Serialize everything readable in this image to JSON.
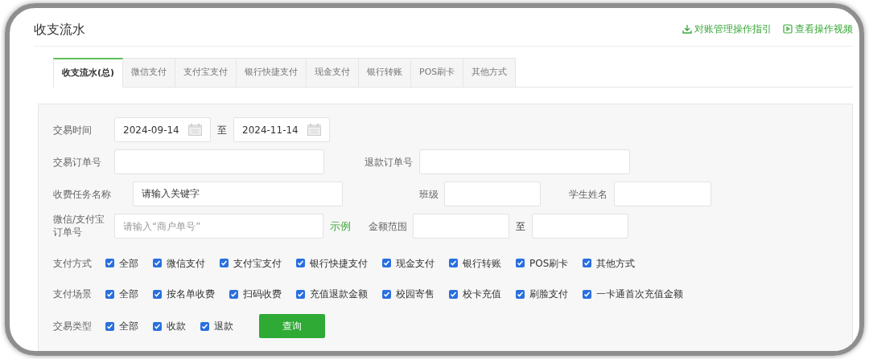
{
  "header": {
    "title": "收支流水",
    "links": [
      {
        "kind": "download",
        "label": "对账管理操作指引"
      },
      {
        "kind": "video",
        "label": "查看操作视频"
      }
    ]
  },
  "tabs": [
    {
      "label": "收支流水(总)",
      "selected": true
    },
    {
      "label": "微信支付",
      "selected": false
    },
    {
      "label": "支付宝支付",
      "selected": false
    },
    {
      "label": "银行快捷支付",
      "selected": false
    },
    {
      "label": "现金支付",
      "selected": false
    },
    {
      "label": "银行转账",
      "selected": false
    },
    {
      "label": "POS刷卡",
      "selected": false
    },
    {
      "label": "其他方式",
      "selected": false
    }
  ],
  "filters": {
    "date": {
      "label": "交易时间",
      "from": "2024-09-14",
      "separator": "至",
      "to": "2024-11-14"
    },
    "order_no": {
      "label": "交易订单号"
    },
    "refund_no": {
      "label": "退款订单号"
    },
    "task_name": {
      "label": "收费任务名称",
      "value": "请输入关键字"
    },
    "class_name": {
      "label": "班级"
    },
    "student": {
      "label": "学生姓名"
    },
    "merchant_no": {
      "label": "微信/支付宝订单号",
      "placeholder": "请输入“商户单号”",
      "example_link": "示例"
    },
    "amount": {
      "label": "金额范围",
      "separator": "至"
    },
    "check_groups": [
      {
        "label": "支付方式",
        "options": [
          {
            "label": "全部",
            "checked": true
          },
          {
            "label": "微信支付",
            "checked": true
          },
          {
            "label": "支付宝支付",
            "checked": true
          },
          {
            "label": "银行快捷支付",
            "checked": true
          },
          {
            "label": "现金支付",
            "checked": true
          },
          {
            "label": "银行转账",
            "checked": true
          },
          {
            "label": "POS刷卡",
            "checked": true
          },
          {
            "label": "其他方式",
            "checked": true
          }
        ]
      },
      {
        "label": "支付场景",
        "options": [
          {
            "label": "全部",
            "checked": true
          },
          {
            "label": "按名单收费",
            "checked": true
          },
          {
            "label": "扫码收费",
            "checked": true
          },
          {
            "label": "充值退款金额",
            "checked": true
          },
          {
            "label": "校园寄售",
            "checked": true
          },
          {
            "label": "校卡充值",
            "checked": true
          },
          {
            "label": "刷脸支付",
            "checked": true
          },
          {
            "label": "一卡通首次充值金额",
            "checked": true
          }
        ]
      },
      {
        "label": "交易类型",
        "options": [
          {
            "label": "全部",
            "checked": true
          },
          {
            "label": "收款",
            "checked": true
          },
          {
            "label": "退款",
            "checked": true
          }
        ]
      }
    ],
    "search_button": "查询"
  }
}
